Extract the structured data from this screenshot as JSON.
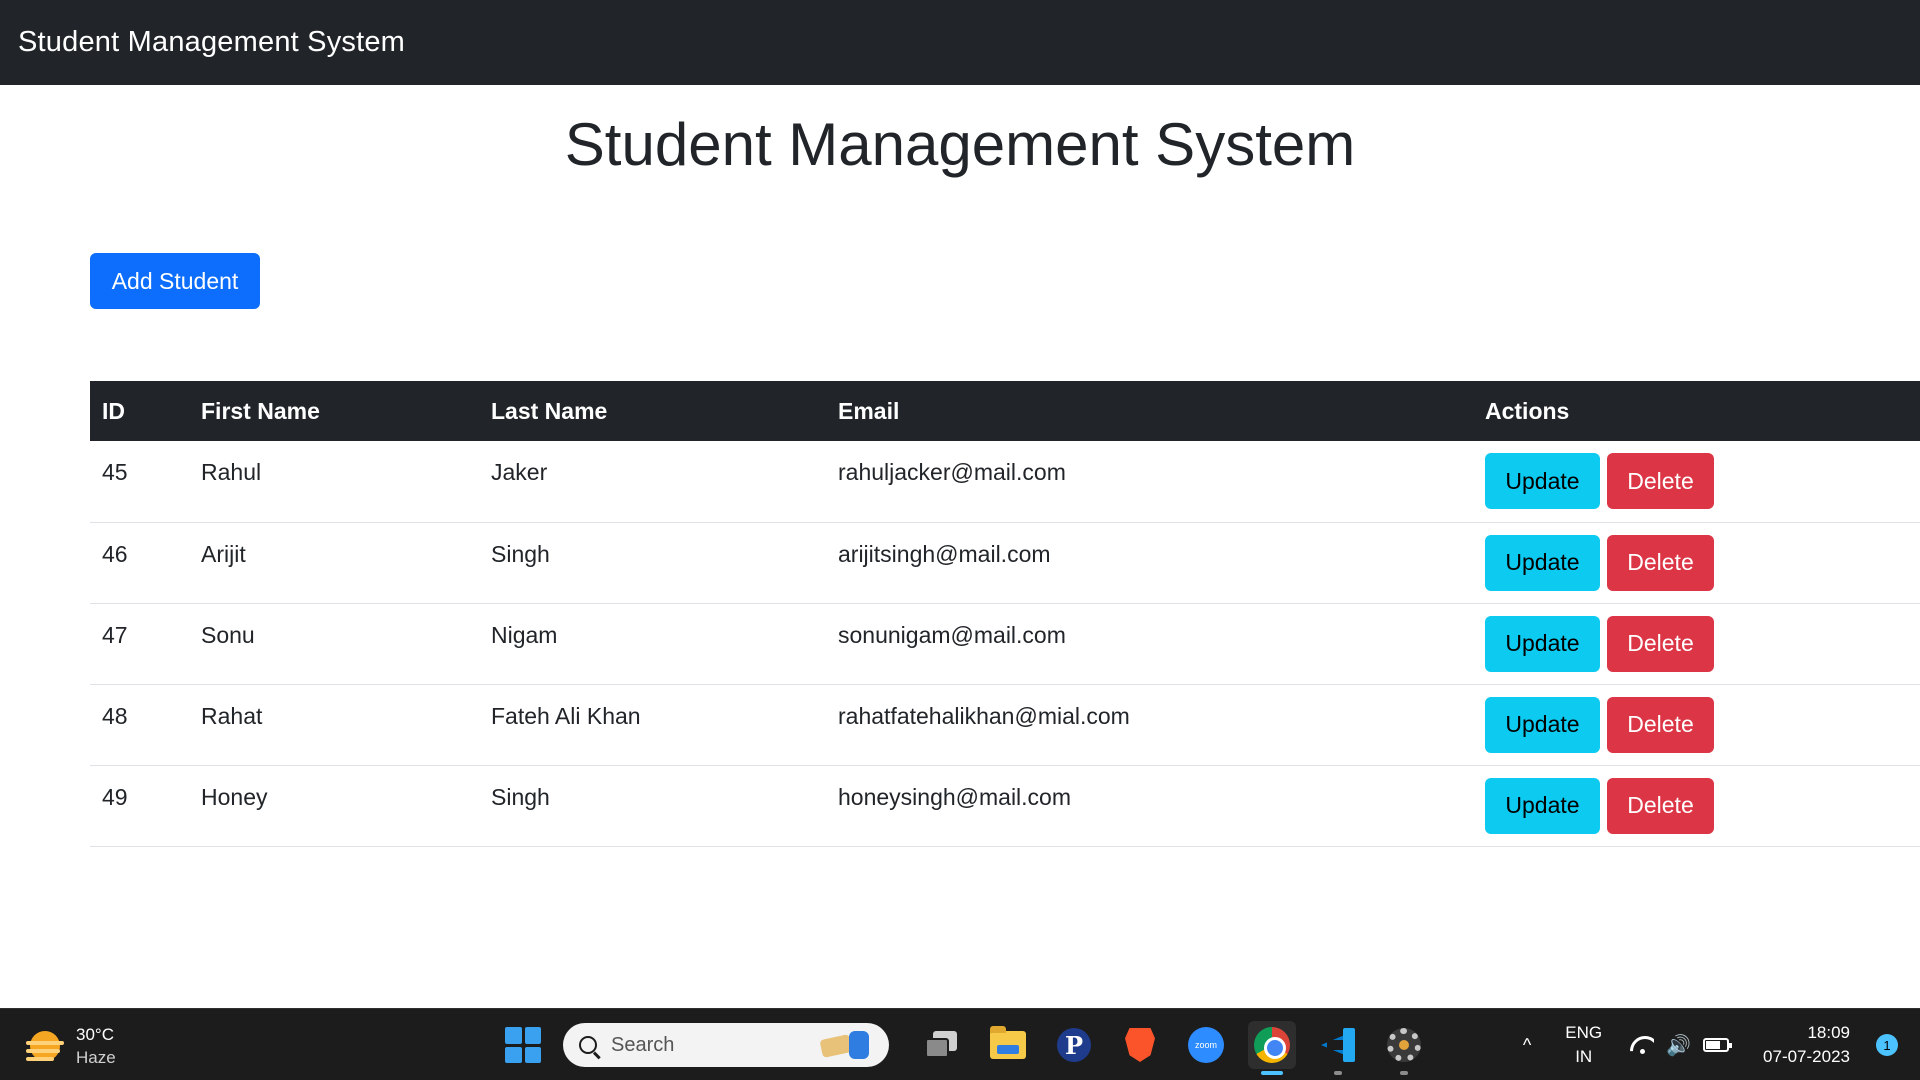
{
  "navbar": {
    "brand": "Student Management System"
  },
  "page": {
    "title": "Student Management System",
    "add_button": "Add Student"
  },
  "table": {
    "headers": [
      "ID",
      "First Name",
      "Last Name",
      "Email",
      "Actions"
    ],
    "update_label": "Update",
    "delete_label": "Delete",
    "rows": [
      {
        "id": "45",
        "first_name": "Rahul",
        "last_name": "Jaker",
        "email": "rahuljacker@mail.com"
      },
      {
        "id": "46",
        "first_name": "Arijit",
        "last_name": "Singh",
        "email": "arijitsingh@mail.com"
      },
      {
        "id": "47",
        "first_name": "Sonu",
        "last_name": "Nigam",
        "email": "sonunigam@mail.com"
      },
      {
        "id": "48",
        "first_name": "Rahat",
        "last_name": "Fateh Ali Khan",
        "email": "rahatfatehalikhan@mial.com"
      },
      {
        "id": "49",
        "first_name": "Honey",
        "last_name": "Singh",
        "email": "honeysingh@mail.com"
      }
    ]
  },
  "taskbar": {
    "weather": {
      "temp": "30°C",
      "condition": "Haze",
      "icon": "haze-weather-icon"
    },
    "search_placeholder": "Search",
    "apps": [
      {
        "name": "task-view-icon"
      },
      {
        "name": "file-explorer-icon"
      },
      {
        "name": "p-app-icon",
        "glyph": "P"
      },
      {
        "name": "brave-browser-icon"
      },
      {
        "name": "zoom-icon",
        "glyph": "zoom"
      },
      {
        "name": "chrome-icon",
        "active": true
      },
      {
        "name": "vscode-icon"
      },
      {
        "name": "gear-app-icon"
      }
    ],
    "tray": {
      "chevron": "^",
      "lang_line1": "ENG",
      "lang_line2": "IN",
      "volume_glyph": "🔊",
      "battery_level": 0.7,
      "time": "18:09",
      "date": "07-07-2023",
      "notification_count": "1"
    }
  },
  "colors": {
    "navbar_bg": "#212529",
    "primary": "#0d6efd",
    "info": "#0dcaf0",
    "danger": "#dc3545",
    "taskbar_bg": "#1c1c1c"
  }
}
